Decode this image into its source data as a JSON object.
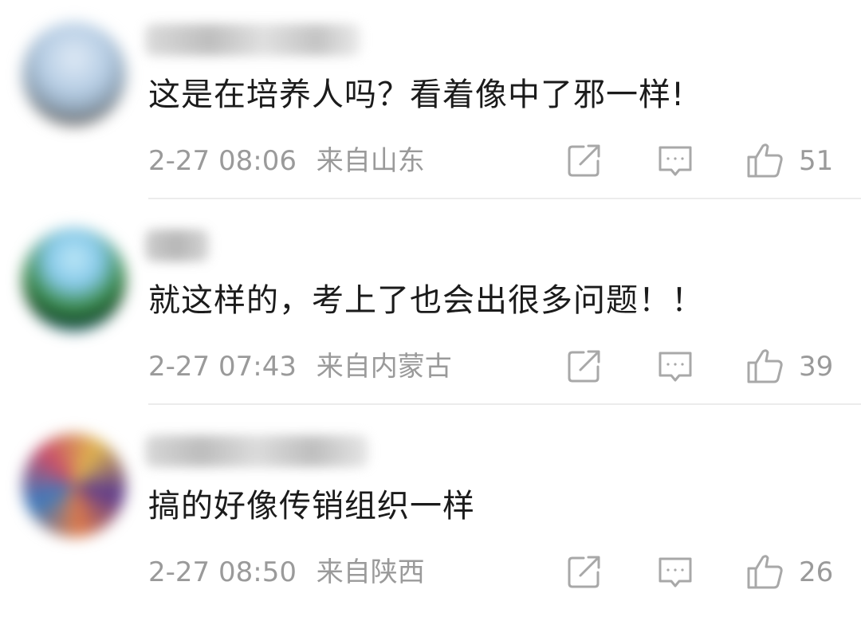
{
  "comments": [
    {
      "text": "这是在培养人吗？看着像中了邪一样!",
      "time": "2-27 08:06",
      "location": "来自山东",
      "likes": "51",
      "avatar_colors": [
        "#bcd3ea",
        "#7a8ea0",
        "#554a40"
      ]
    },
    {
      "text": "就这样的，考上了也会出很多问题！！",
      "time": "2-27 07:43",
      "location": "来自内蒙古",
      "likes": "39",
      "avatar_colors": [
        "#8fd2ee",
        "#1e5c2a",
        "#3f8cc9"
      ]
    },
    {
      "text": "搞的好像传销组织一样",
      "time": "2-27 08:50",
      "location": "来自陕西",
      "likes": "26",
      "avatar_colors": [
        "#e0b54d",
        "#5b3a8e",
        "#e07b48"
      ]
    }
  ],
  "icons": {
    "share": "share-icon",
    "reply": "reply-icon",
    "like": "thumbs-up-icon"
  },
  "colors": {
    "text": "#1b1b1b",
    "meta": "#9a9a9a",
    "divider": "#ececec"
  }
}
